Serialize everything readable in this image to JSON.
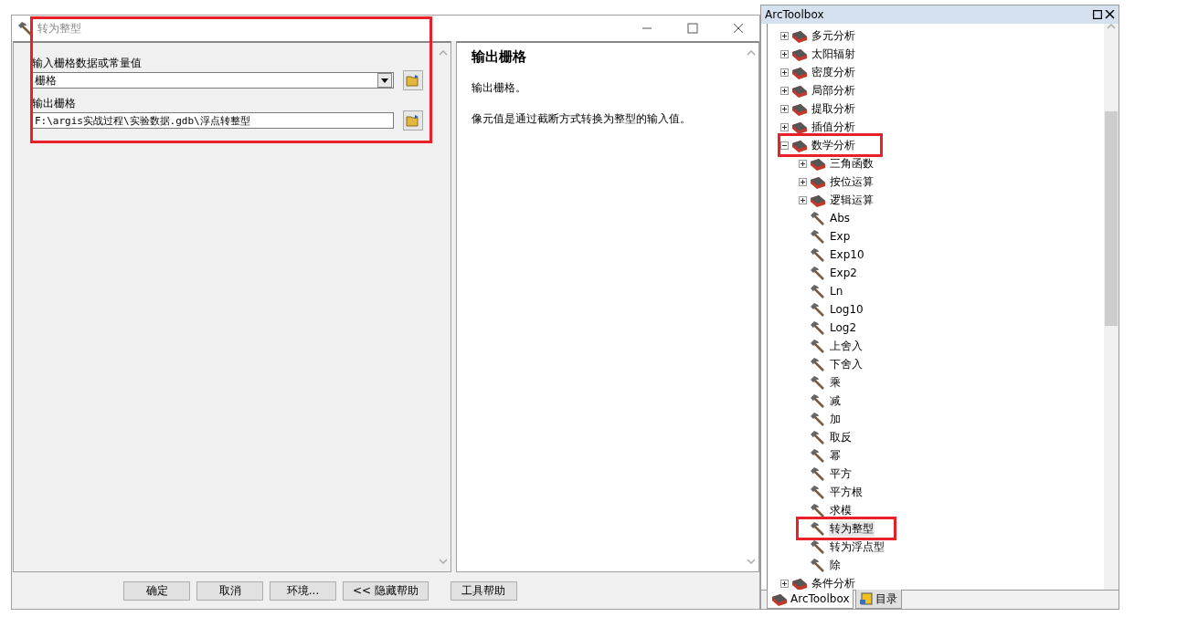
{
  "dialog": {
    "title": "转为整型",
    "marked": true,
    "fields": [
      {
        "label": "输入栅格数据或常量值",
        "kind": "dropdown",
        "value": "栅格"
      },
      {
        "label": "输出栅格",
        "kind": "text",
        "value": "F:\\argis实战过程\\实验数据.gdb\\浮点转整型"
      }
    ],
    "help": {
      "heading": "输出栅格",
      "paragraphs": [
        "输出栅格。",
        "像元值是通过截断方式转换为整型的输入值。"
      ]
    },
    "buttons": [
      "确定",
      "取消",
      "环境...",
      "<< 隐藏帮助",
      "工具帮助"
    ]
  },
  "toolbox": {
    "title": "ArcToolbox",
    "items": [
      {
        "label": "多元分析",
        "kind": "toolset",
        "expanded": false,
        "marked": false,
        "selected": false
      },
      {
        "label": "太阳辐射",
        "kind": "toolset",
        "expanded": false,
        "marked": false,
        "selected": false
      },
      {
        "label": "密度分析",
        "kind": "toolset",
        "expanded": false,
        "marked": false,
        "selected": false
      },
      {
        "label": "局部分析",
        "kind": "toolset",
        "expanded": false,
        "marked": false,
        "selected": false
      },
      {
        "label": "提取分析",
        "kind": "toolset",
        "expanded": false,
        "marked": false,
        "selected": false
      },
      {
        "label": "插值分析",
        "kind": "toolset",
        "expanded": false,
        "marked": false,
        "selected": false
      },
      {
        "label": "数学分析",
        "kind": "toolset",
        "expanded": true,
        "marked": true,
        "selected": false,
        "children": [
          {
            "label": "三角函数",
            "kind": "toolset",
            "expanded": false,
            "marked": false,
            "selected": false
          },
          {
            "label": "按位运算",
            "kind": "toolset",
            "expanded": false,
            "marked": false,
            "selected": false
          },
          {
            "label": "逻辑运算",
            "kind": "toolset",
            "expanded": false,
            "marked": false,
            "selected": false
          },
          {
            "label": "Abs",
            "kind": "tool",
            "marked": false,
            "selected": false
          },
          {
            "label": "Exp",
            "kind": "tool",
            "marked": false,
            "selected": false
          },
          {
            "label": "Exp10",
            "kind": "tool",
            "marked": false,
            "selected": false
          },
          {
            "label": "Exp2",
            "kind": "tool",
            "marked": false,
            "selected": false
          },
          {
            "label": "Ln",
            "kind": "tool",
            "marked": false,
            "selected": false
          },
          {
            "label": "Log10",
            "kind": "tool",
            "marked": false,
            "selected": false
          },
          {
            "label": "Log2",
            "kind": "tool",
            "marked": false,
            "selected": false
          },
          {
            "label": "上舍入",
            "kind": "tool",
            "marked": false,
            "selected": false
          },
          {
            "label": "下舍入",
            "kind": "tool",
            "marked": false,
            "selected": false
          },
          {
            "label": "乘",
            "kind": "tool",
            "marked": false,
            "selected": false
          },
          {
            "label": "减",
            "kind": "tool",
            "marked": false,
            "selected": false
          },
          {
            "label": "加",
            "kind": "tool",
            "marked": false,
            "selected": false
          },
          {
            "label": "取反",
            "kind": "tool",
            "marked": false,
            "selected": false
          },
          {
            "label": "幂",
            "kind": "tool",
            "marked": false,
            "selected": false
          },
          {
            "label": "平方",
            "kind": "tool",
            "marked": false,
            "selected": false
          },
          {
            "label": "平方根",
            "kind": "tool",
            "marked": false,
            "selected": false
          },
          {
            "label": "求模",
            "kind": "tool",
            "marked": false,
            "selected": false
          },
          {
            "label": "转为整型",
            "kind": "tool",
            "marked": true,
            "selected": true
          },
          {
            "label": "转为浮点型",
            "kind": "tool",
            "marked": false,
            "selected": false
          },
          {
            "label": "除",
            "kind": "tool",
            "marked": false,
            "selected": false
          }
        ]
      },
      {
        "label": "条件分析",
        "kind": "toolset",
        "expanded": false,
        "marked": false,
        "selected": false
      }
    ],
    "tabs": [
      {
        "label": "ArcToolbox",
        "selected": true
      },
      {
        "label": "目录",
        "selected": false
      }
    ]
  }
}
